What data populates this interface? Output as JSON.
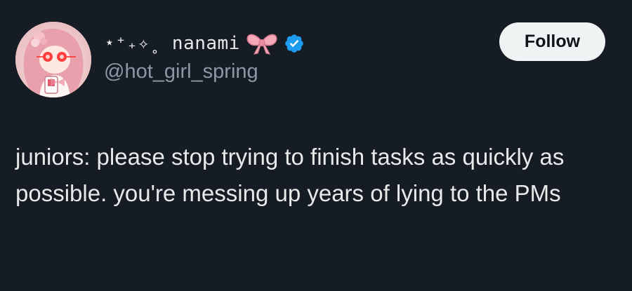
{
  "author": {
    "display_name": "⋆⁺₊✧˳ nanami",
    "handle": "@hot_girl_spring",
    "verified": true,
    "badge_icons": [
      "pink-bow-icon",
      "verified-badge-icon"
    ],
    "verified_color": "#1d9bf0"
  },
  "actions": {
    "follow_label": "Follow"
  },
  "tweet": {
    "text": "juniors: please stop trying to finish tasks as quickly as possible. you're messing up years of lying to the PMs"
  },
  "colors": {
    "background": "#161c24",
    "text": "#e7e9ea",
    "secondary_text": "#8b98a5",
    "button_bg": "#eff3f4"
  }
}
